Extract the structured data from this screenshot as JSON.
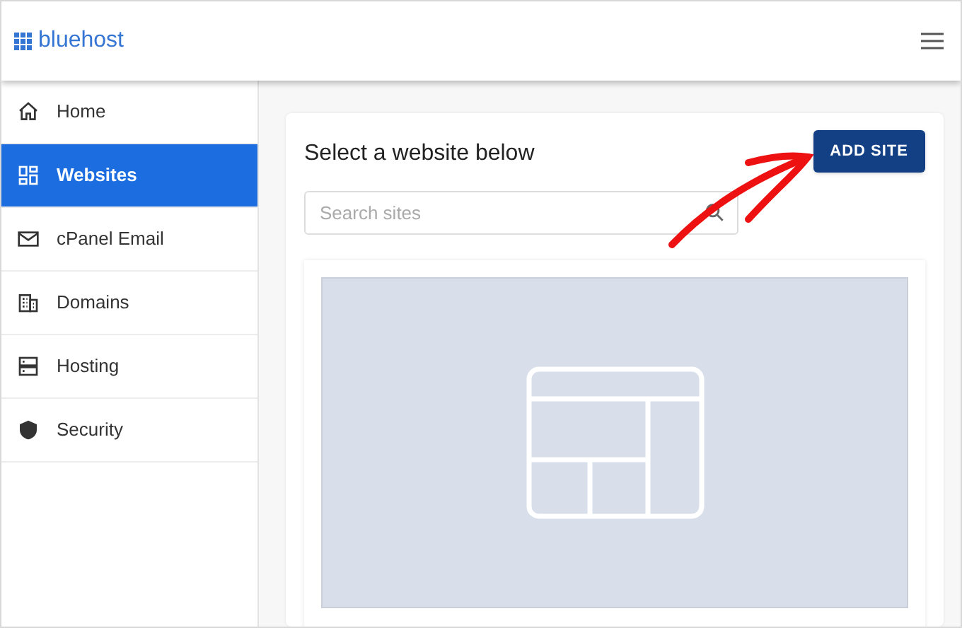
{
  "header": {
    "logo_text": "bluehost"
  },
  "sidebar": {
    "items": [
      {
        "label": "Home",
        "selected": false
      },
      {
        "label": "Websites",
        "selected": true
      },
      {
        "label": "cPanel Email",
        "selected": false
      },
      {
        "label": "Domains",
        "selected": false
      },
      {
        "label": "Hosting",
        "selected": false
      },
      {
        "label": "Security",
        "selected": false
      }
    ]
  },
  "main": {
    "heading": "Select a website below",
    "add_button": "ADD SITE",
    "search": {
      "placeholder": "Search sites"
    },
    "site_card": {
      "kind": "placeholder"
    }
  }
}
